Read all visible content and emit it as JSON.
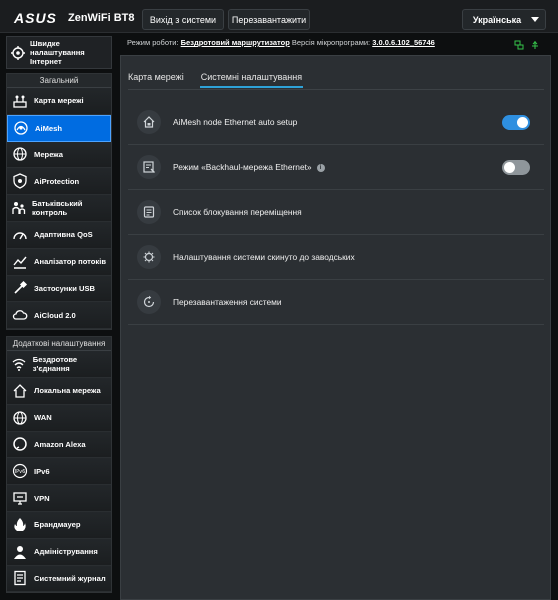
{
  "header": {
    "logo": "ASUS",
    "product": "ZenWiFi BT8",
    "logout_label": "Вихід з системи",
    "reboot_label": "Перезавантажити",
    "language": "Українська"
  },
  "status": {
    "mode_label": "Режим роботи:",
    "mode_value": "Бездротовий маршрутизатор",
    "firmware_label": "Версія мікропрограми:",
    "firmware_value": "3.0.0.6.102_56746"
  },
  "sidebar": {
    "quick_setup": "Швидке налаштування Інтернет",
    "general_title": "Загальний",
    "general_items": [
      {
        "label": "Карта мережі",
        "icon": "network-map-icon"
      },
      {
        "label": "AiMesh",
        "icon": "aimesh-icon"
      },
      {
        "label": "Мережа",
        "icon": "globe-icon"
      },
      {
        "label": "AiProtection",
        "icon": "shield-icon"
      },
      {
        "label": "Батьківський контроль",
        "icon": "parental-control-icon"
      },
      {
        "label": "Адаптивна QoS",
        "icon": "speedometer-icon"
      },
      {
        "label": "Аналізатор потоків",
        "icon": "traffic-analyzer-icon"
      },
      {
        "label": "Застосунки USB",
        "icon": "usb-icon"
      },
      {
        "label": "AiCloud 2.0",
        "icon": "cloud-icon"
      }
    ],
    "advanced_title": "Додаткові налаштування",
    "advanced_items": [
      {
        "label": "Бездротове з'єднання",
        "icon": "wifi-icon"
      },
      {
        "label": "Локальна мережа",
        "icon": "home-icon"
      },
      {
        "label": "WAN",
        "icon": "globe-icon"
      },
      {
        "label": "Amazon Alexa",
        "icon": "alexa-icon"
      },
      {
        "label": "IPv6",
        "icon": "ipv6-icon"
      },
      {
        "label": "VPN",
        "icon": "vpn-icon"
      },
      {
        "label": "Брандмауер",
        "icon": "firewall-icon"
      },
      {
        "label": "Адміністрування",
        "icon": "admin-icon"
      },
      {
        "label": "Системний журнал",
        "icon": "log-icon"
      }
    ]
  },
  "tabs": [
    {
      "label": "Карта мережі",
      "active": false
    },
    {
      "label": "Системні налаштування",
      "active": true
    }
  ],
  "settings": [
    {
      "label": "AiMesh node Ethernet auto setup",
      "toggle": "on",
      "info": false
    },
    {
      "label": "Режим «Backhaul-мережа Ethernet»",
      "toggle": "off",
      "info": true
    },
    {
      "label": "Список блокування переміщення",
      "toggle": null,
      "info": false
    },
    {
      "label": "Налаштування системи скинуто до заводських",
      "toggle": null,
      "info": false
    },
    {
      "label": "Перезавантаження системи",
      "toggle": null,
      "info": false
    }
  ],
  "colors": {
    "accent": "#006ce1",
    "toggle_on": "#2e8fe0",
    "tab_underline": "#2ea2d8"
  }
}
